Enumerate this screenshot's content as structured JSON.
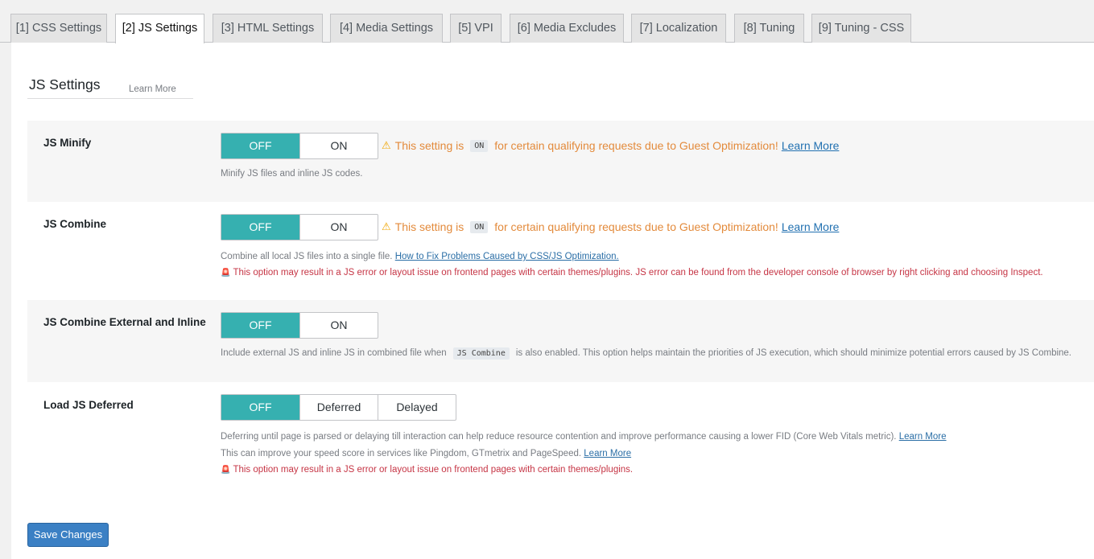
{
  "tabs": [
    {
      "label": "[1] CSS Settings"
    },
    {
      "label": "[2] JS Settings"
    },
    {
      "label": "[3] HTML Settings"
    },
    {
      "label": "[4] Media Settings"
    },
    {
      "label": "[5] VPI"
    },
    {
      "label": "[6] Media Excludes"
    },
    {
      "label": "[7] Localization"
    },
    {
      "label": "[8] Tuning"
    },
    {
      "label": "[9] Tuning - CSS"
    }
  ],
  "active_tab": "[2] JS Settings",
  "section": {
    "title": "JS Settings",
    "learn_more": "Learn More"
  },
  "settings": {
    "js_minify": {
      "label": "JS Minify",
      "options": [
        "OFF",
        "ON"
      ],
      "selected": "OFF",
      "warning": {
        "pre": "This setting is",
        "code": "ON",
        "post": "for certain qualifying requests due to Guest Optimization!",
        "link": "Learn More"
      },
      "desc": "Minify JS files and inline JS codes."
    },
    "js_combine": {
      "label": "JS Combine",
      "options": [
        "OFF",
        "ON"
      ],
      "selected": "OFF",
      "warning": {
        "pre": "This setting is",
        "code": "ON",
        "post": "for certain qualifying requests due to Guest Optimization!",
        "link": "Learn More"
      },
      "desc": "Combine all local JS files into a single file.",
      "desc_link": "How to Fix Problems Caused by CSS/JS Optimization.",
      "danger": "This option may result in a JS error or layout issue on frontend pages with certain themes/plugins. JS error can be found from the developer console of browser by right clicking and choosing Inspect."
    },
    "js_combine_external": {
      "label": "JS Combine External and Inline",
      "options": [
        "OFF",
        "ON"
      ],
      "selected": "OFF",
      "desc_pre": "Include external JS and inline JS in combined file when",
      "desc_code": "JS Combine",
      "desc_post": "is also enabled. This option helps maintain the priorities of JS execution, which should minimize potential errors caused by JS Combine."
    },
    "load_js_deferred": {
      "label": "Load JS Deferred",
      "options": [
        "OFF",
        "Deferred",
        "Delayed"
      ],
      "selected": "OFF",
      "desc1": "Deferring until page is parsed or delaying till interaction can help reduce resource contention and improve performance causing a lower FID (Core Web Vitals metric).",
      "desc1_link": "Learn More",
      "desc2": "This can improve your speed score in services like Pingdom, GTmetrix and PageSpeed.",
      "desc2_link": "Learn More",
      "danger": "This option may result in a JS error or layout issue on frontend pages with certain themes/plugins."
    }
  },
  "save_button": "Save Changes",
  "colors": {
    "toggle_on": "#36b0b0",
    "warning": "#e38a3b",
    "danger": "#c63545",
    "primary": "#3b80c4"
  }
}
